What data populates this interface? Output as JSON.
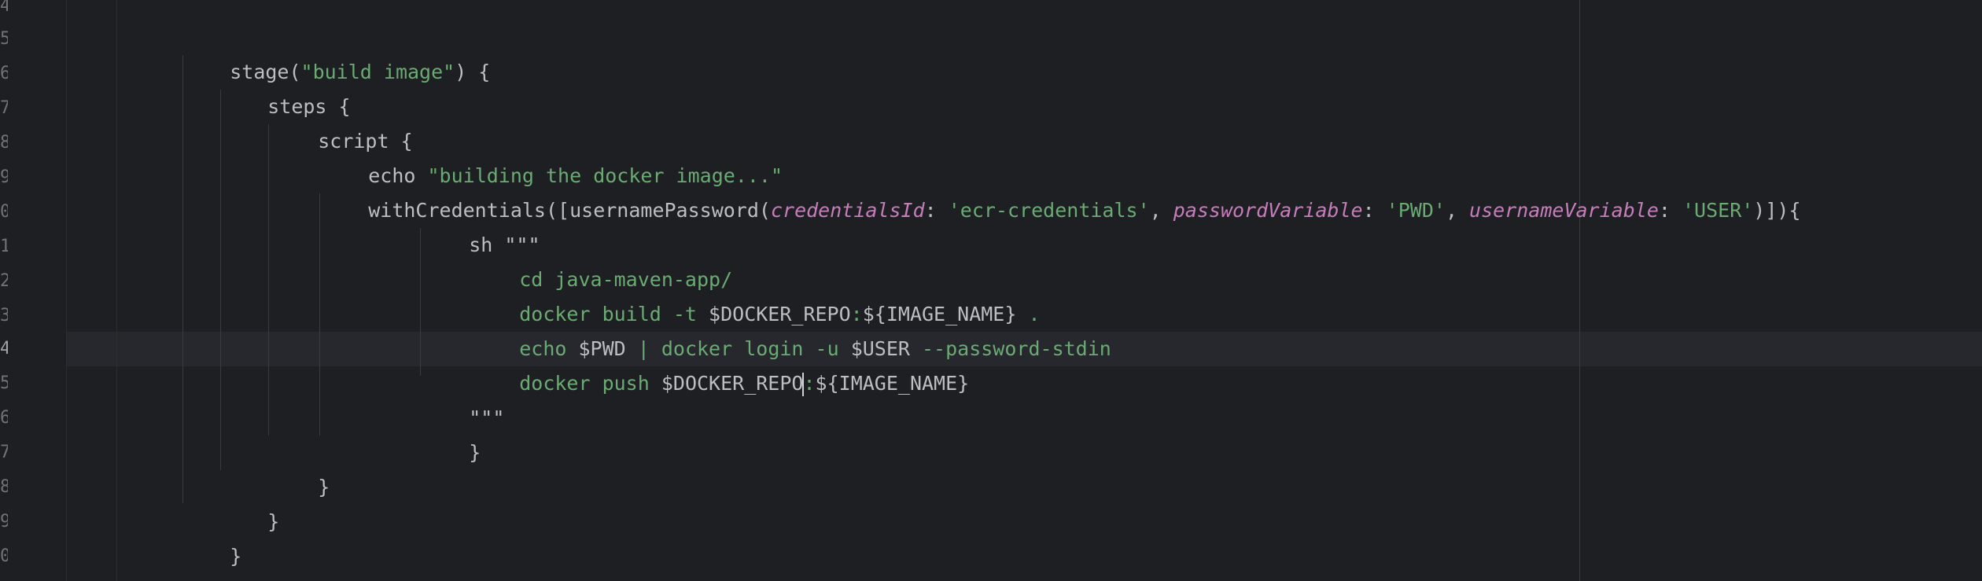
{
  "editor": {
    "gutter_numbers": [
      "4",
      "5",
      "6",
      "7",
      "8",
      "9",
      "0",
      "1",
      "2",
      "3",
      "4",
      "5",
      "6",
      "7",
      "8",
      "9",
      "0"
    ],
    "lines": {
      "stage_open": {
        "kw": "stage(",
        "str": "\"build image\"",
        "rest": ") {"
      },
      "steps_open": "steps {",
      "script_open": "script {",
      "echo": {
        "kw": "echo ",
        "str": "\"building the docker image...\""
      },
      "with_credentials": {
        "fn": "withCredentials([usernamePassword(",
        "p1": "credentialsId",
        "sep1": ": ",
        "v1": "'ecr-credentials'",
        "comma1": ", ",
        "p2": "passwordVariable",
        "sep2": ": ",
        "v2": "'PWD'",
        "comma2": ", ",
        "p3": "usernameVariable",
        "sep3": ": ",
        "v3": "'USER'",
        "close": ")]){"
      },
      "sh_open": {
        "kw": "sh ",
        "str": "\"\"\""
      },
      "cd": "cd java-maven-app/",
      "docker_build": {
        "a": "docker build -t ",
        "b": "$DOCKER_REPO",
        "c": ":",
        "d": "${IMAGE_NAME}",
        "e": " ."
      },
      "login": {
        "a": "echo ",
        "b": "$PWD",
        "c": " | docker login -u ",
        "d": "$USER",
        "e": " --password-stdin"
      },
      "push": {
        "a": "docker push ",
        "b1": "$DOCKER_REP",
        "b2": "O",
        "c": ":",
        "d": "${IMAGE_NAME}"
      },
      "sh_close": "\"\"\"",
      "brace_wc": "}",
      "brace_script": "}",
      "brace_steps": "}",
      "brace_stage": "}"
    },
    "colors": {
      "background": "#1e1f22",
      "text": "#bcbec4",
      "string": "#6aab73",
      "named_param": "#c77dbb",
      "current_line": "#26282e"
    }
  }
}
